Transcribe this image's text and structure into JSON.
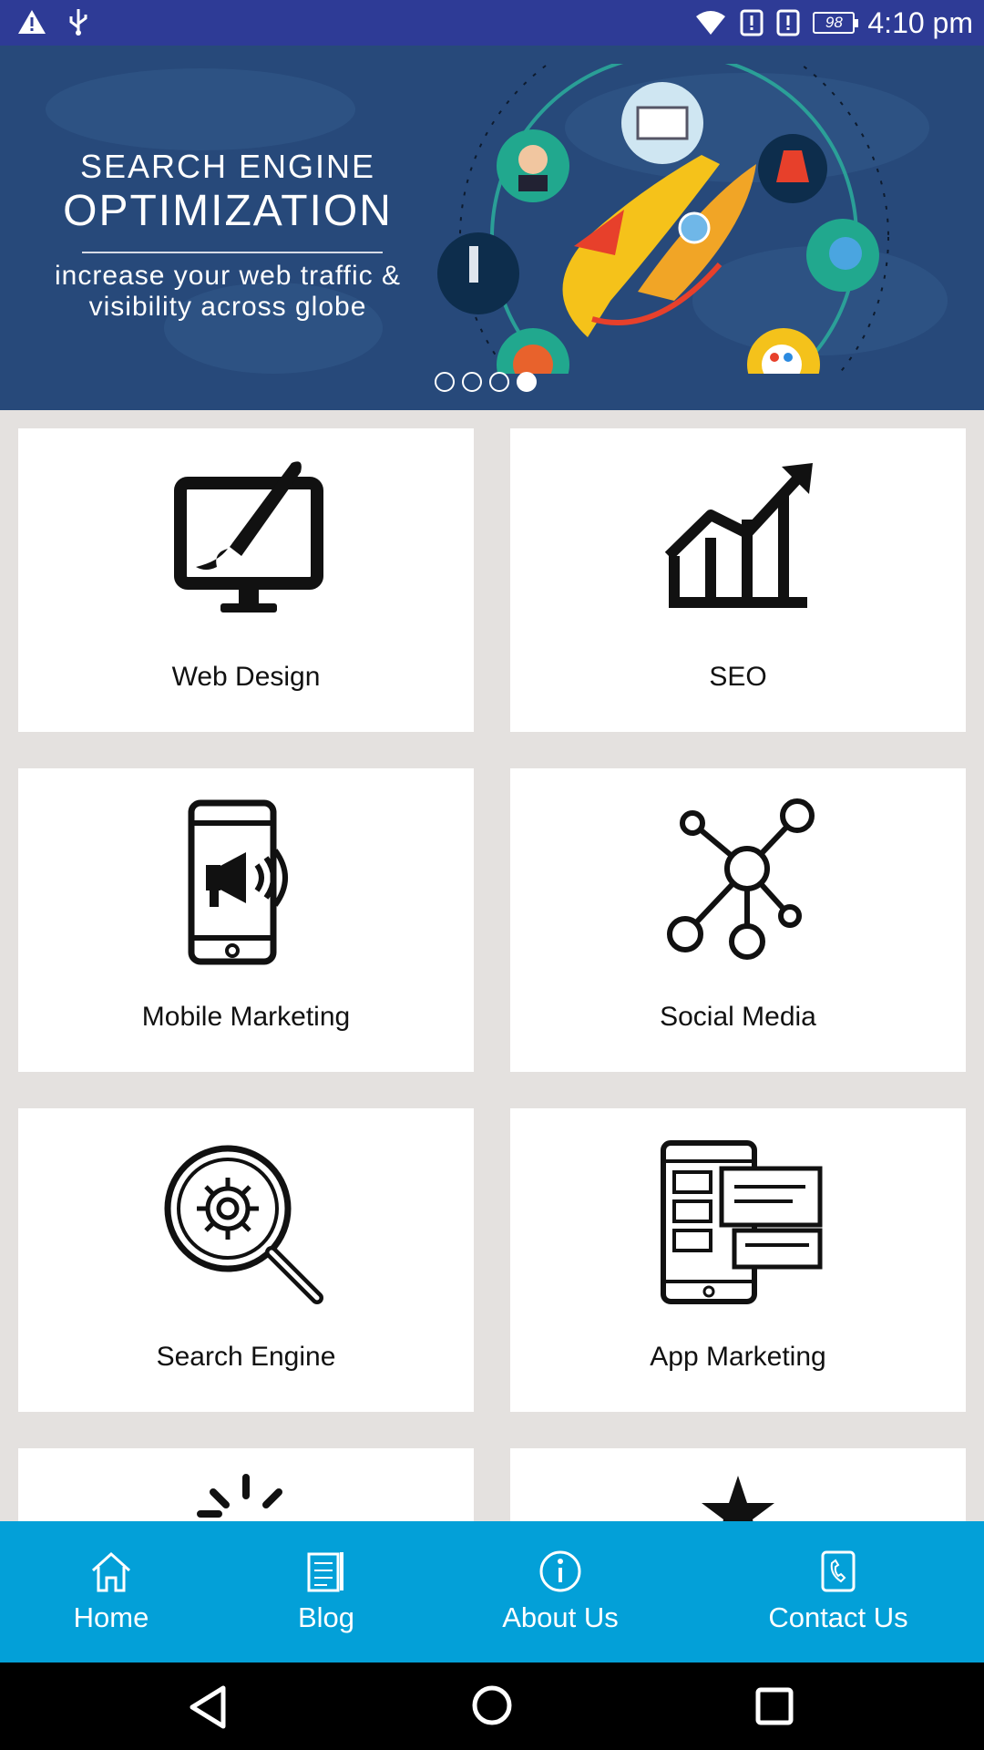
{
  "status_bar": {
    "time": "4:10 pm",
    "battery": "98",
    "icons": [
      "warning-icon",
      "usb-icon",
      "wifi-icon",
      "alert-icon",
      "alert-icon",
      "battery-icon"
    ]
  },
  "banner": {
    "title_small": "SEARCH ENGINE",
    "title_big": "OPTIMIZATION",
    "subtitle_line1": "increase your web traffic &",
    "subtitle_line2": "visibility across globe",
    "slides": 4,
    "active_slide": 4
  },
  "services": [
    {
      "label": "Web Design",
      "icon": "monitor-brush-icon"
    },
    {
      "label": "SEO",
      "icon": "growth-chart-icon"
    },
    {
      "label": "Mobile Marketing",
      "icon": "phone-megaphone-icon"
    },
    {
      "label": "Social Media",
      "icon": "network-icon"
    },
    {
      "label": "Search Engine",
      "icon": "magnifier-gear-icon"
    },
    {
      "label": "App Marketing",
      "icon": "app-screens-icon"
    }
  ],
  "bottom_nav": [
    {
      "label": "Home",
      "icon": "home-icon"
    },
    {
      "label": "Blog",
      "icon": "blog-icon"
    },
    {
      "label": "About Us",
      "icon": "info-icon"
    },
    {
      "label": "Contact Us",
      "icon": "phone-icon"
    }
  ],
  "colors": {
    "status_bar": "#2e3b96",
    "banner": "#27497a",
    "nav": "#03a0d8",
    "page_bg": "#e4e1df"
  }
}
